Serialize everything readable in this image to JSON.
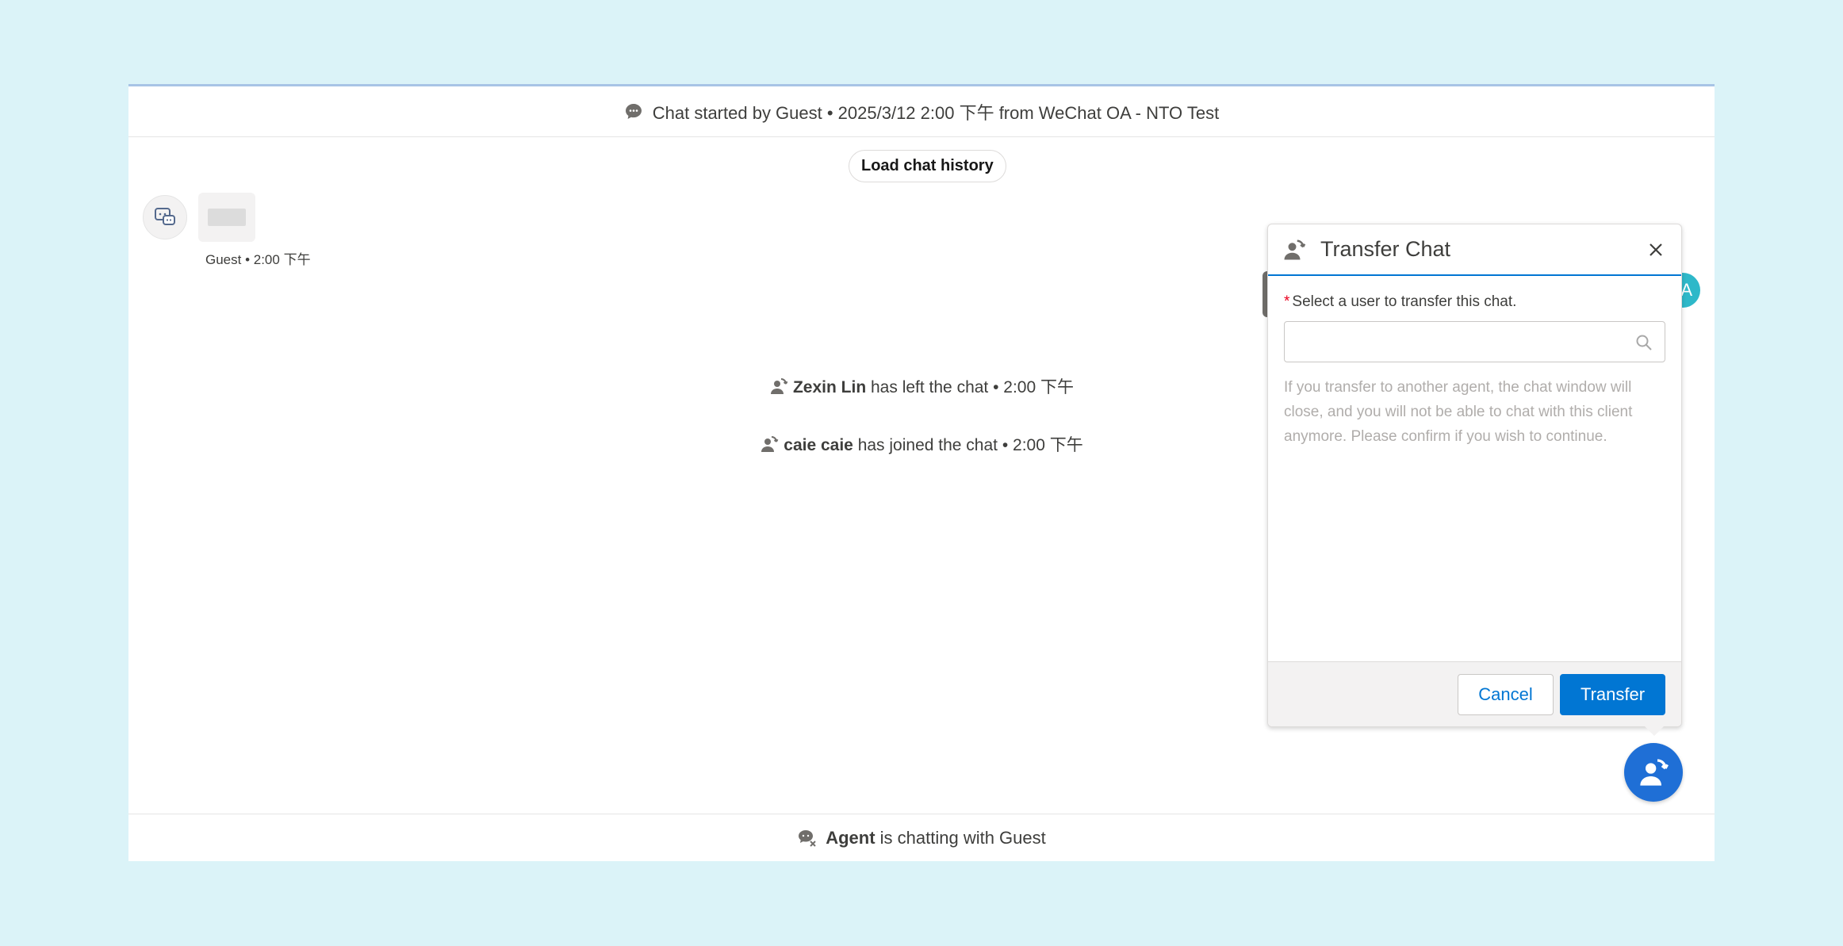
{
  "header": {
    "text": "Chat started by Guest • 2025/3/12 2:00 下午 from WeChat OA - NTO Test"
  },
  "load_history_label": "Load chat history",
  "guest_message": {
    "meta": "Guest • 2:00 下午"
  },
  "events": [
    {
      "name": "Zexin Lin",
      "text": " has left the chat • 2:00 下午"
    },
    {
      "name": "caie caie",
      "text": " has joined the chat • 2:00 下午"
    }
  ],
  "agent_avatar_letter": "A",
  "footer": {
    "agent": "Agent",
    "text": " is chatting with Guest"
  },
  "dialog": {
    "title": "Transfer Chat",
    "required_mark": "*",
    "label": "Select a user to transfer this chat.",
    "search_value": "",
    "search_placeholder": "",
    "note": "If you transfer to another agent, the chat window will close, and you will not be able to chat with this client anymore. Please confirm if you wish to continue.",
    "cancel_label": "Cancel",
    "transfer_label": "Transfer"
  },
  "colors": {
    "brand": "#0176d3",
    "fab": "#1f6fd6",
    "agent_avatar": "#2eb8c9",
    "background": "#dbf3f8"
  },
  "icons": {
    "header": "chat-bubble-icon",
    "guest_avatar": "wechat-chat-icon",
    "event": "transfer-agent-icon",
    "footer": "agent-chatting-icon",
    "search": "search-icon",
    "close": "close-icon",
    "fab": "transfer-agent-icon"
  }
}
